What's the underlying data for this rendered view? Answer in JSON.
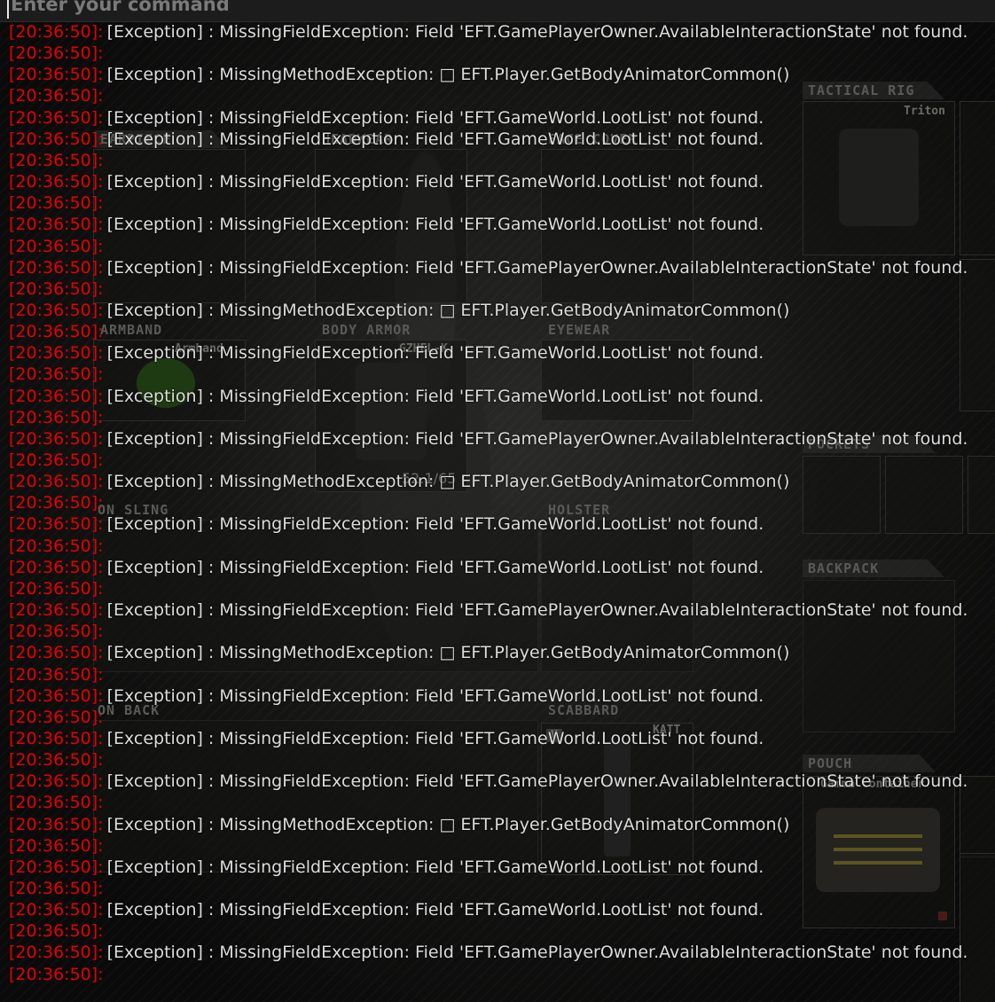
{
  "console": {
    "input_placeholder": "Enter your command",
    "timestamp_color": "#e60000",
    "message_color": "#dcdcdc",
    "lines": [
      {
        "ts": "[20:36:50]:",
        "msg": "[Exception] : MissingFieldException: Field 'EFT.GamePlayerOwner.AvailableInteractionState' not found."
      },
      {
        "ts": "[20:36:50]:",
        "msg": ""
      },
      {
        "ts": "[20:36:50]:",
        "msg": "[Exception] : MissingMethodException: □ EFT.Player.GetBodyAnimatorCommon()"
      },
      {
        "ts": "[20:36:50]:",
        "msg": ""
      },
      {
        "ts": "[20:36:50]:",
        "msg": "[Exception] : MissingFieldException: Field 'EFT.GameWorld.LootList' not found."
      },
      {
        "ts": "[20:36:50]:",
        "msg": "[Exception] : MissingFieldException: Field 'EFT.GameWorld.LootList' not found."
      },
      {
        "ts": "[20:36:50]:",
        "msg": ""
      },
      {
        "ts": "[20:36:50]:",
        "msg": "[Exception] : MissingFieldException: Field 'EFT.GameWorld.LootList' not found."
      },
      {
        "ts": "[20:36:50]:",
        "msg": ""
      },
      {
        "ts": "[20:36:50]:",
        "msg": "[Exception] : MissingFieldException: Field 'EFT.GameWorld.LootList' not found."
      },
      {
        "ts": "[20:36:50]:",
        "msg": ""
      },
      {
        "ts": "[20:36:50]:",
        "msg": "[Exception] : MissingFieldException: Field 'EFT.GamePlayerOwner.AvailableInteractionState' not found."
      },
      {
        "ts": "[20:36:50]:",
        "msg": ""
      },
      {
        "ts": "[20:36:50]:",
        "msg": "[Exception] : MissingMethodException: □ EFT.Player.GetBodyAnimatorCommon()"
      },
      {
        "ts": "[20:36:50]:",
        "msg": ""
      },
      {
        "ts": "[20:36:50]:",
        "msg": "[Exception] : MissingFieldException: Field 'EFT.GameWorld.LootList' not found."
      },
      {
        "ts": "[20:36:50]:",
        "msg": ""
      },
      {
        "ts": "[20:36:50]:",
        "msg": "[Exception] : MissingFieldException: Field 'EFT.GameWorld.LootList' not found."
      },
      {
        "ts": "[20:36:50]:",
        "msg": ""
      },
      {
        "ts": "[20:36:50]:",
        "msg": "[Exception] : MissingFieldException: Field 'EFT.GamePlayerOwner.AvailableInteractionState' not found."
      },
      {
        "ts": "[20:36:50]:",
        "msg": ""
      },
      {
        "ts": "[20:36:50]:",
        "msg": "[Exception] : MissingMethodException: □ EFT.Player.GetBodyAnimatorCommon()"
      },
      {
        "ts": "[20:36:50]:",
        "msg": ""
      },
      {
        "ts": "[20:36:50]:",
        "msg": "[Exception] : MissingFieldException: Field 'EFT.GameWorld.LootList' not found."
      },
      {
        "ts": "[20:36:50]:",
        "msg": ""
      },
      {
        "ts": "[20:36:50]:",
        "msg": "[Exception] : MissingFieldException: Field 'EFT.GameWorld.LootList' not found."
      },
      {
        "ts": "[20:36:50]:",
        "msg": ""
      },
      {
        "ts": "[20:36:50]:",
        "msg": "[Exception] : MissingFieldException: Field 'EFT.GamePlayerOwner.AvailableInteractionState' not found."
      },
      {
        "ts": "[20:36:50]:",
        "msg": ""
      },
      {
        "ts": "[20:36:50]:",
        "msg": "[Exception] : MissingMethodException: □ EFT.Player.GetBodyAnimatorCommon()"
      },
      {
        "ts": "[20:36:50]:",
        "msg": ""
      },
      {
        "ts": "[20:36:50]:",
        "msg": "[Exception] : MissingFieldException: Field 'EFT.GameWorld.LootList' not found."
      },
      {
        "ts": "[20:36:50]:",
        "msg": ""
      },
      {
        "ts": "[20:36:50]:",
        "msg": "[Exception] : MissingFieldException: Field 'EFT.GameWorld.LootList' not found."
      },
      {
        "ts": "[20:36:50]:",
        "msg": ""
      },
      {
        "ts": "[20:36:50]:",
        "msg": "[Exception] : MissingFieldException: Field 'EFT.GamePlayerOwner.AvailableInteractionState' not found."
      },
      {
        "ts": "[20:36:50]:",
        "msg": ""
      },
      {
        "ts": "[20:36:50]:",
        "msg": "[Exception] : MissingMethodException: □ EFT.Player.GetBodyAnimatorCommon()"
      },
      {
        "ts": "[20:36:50]:",
        "msg": ""
      },
      {
        "ts": "[20:36:50]:",
        "msg": "[Exception] : MissingFieldException: Field 'EFT.GameWorld.LootList' not found."
      },
      {
        "ts": "[20:36:50]:",
        "msg": ""
      },
      {
        "ts": "[20:36:50]:",
        "msg": "[Exception] : MissingFieldException: Field 'EFT.GameWorld.LootList' not found."
      },
      {
        "ts": "[20:36:50]:",
        "msg": ""
      },
      {
        "ts": "[20:36:50]:",
        "msg": "[Exception] : MissingFieldException: Field 'EFT.GamePlayerOwner.AvailableInteractionState' not found."
      },
      {
        "ts": "[20:36:50]:",
        "msg": ""
      }
    ]
  },
  "inventory": {
    "slots": {
      "tactical_rig": "TACTICAL RIG",
      "earpiece": "EARPIECE",
      "headwear": "HEADWEAR",
      "face_cover": "FACE COVER",
      "armband": "ARMBAND",
      "body_armor": "BODY ARMOR",
      "eyewear": "EYEWEAR",
      "pockets": "POCKETS",
      "on_sling": "ON SLING",
      "holster": "HOLSTER",
      "backpack": "BACKPACK",
      "on_back": "ON BACK",
      "scabbard": "SCABBARD",
      "pouch": "POUCH"
    },
    "items": {
      "rig": "Triton",
      "armband": "Armband",
      "armor": "GZHEL-K",
      "armor_durability": "52.1/65",
      "scabbard": "KATT",
      "scabbard_badge": "V",
      "pouch": "Gamma container"
    }
  }
}
